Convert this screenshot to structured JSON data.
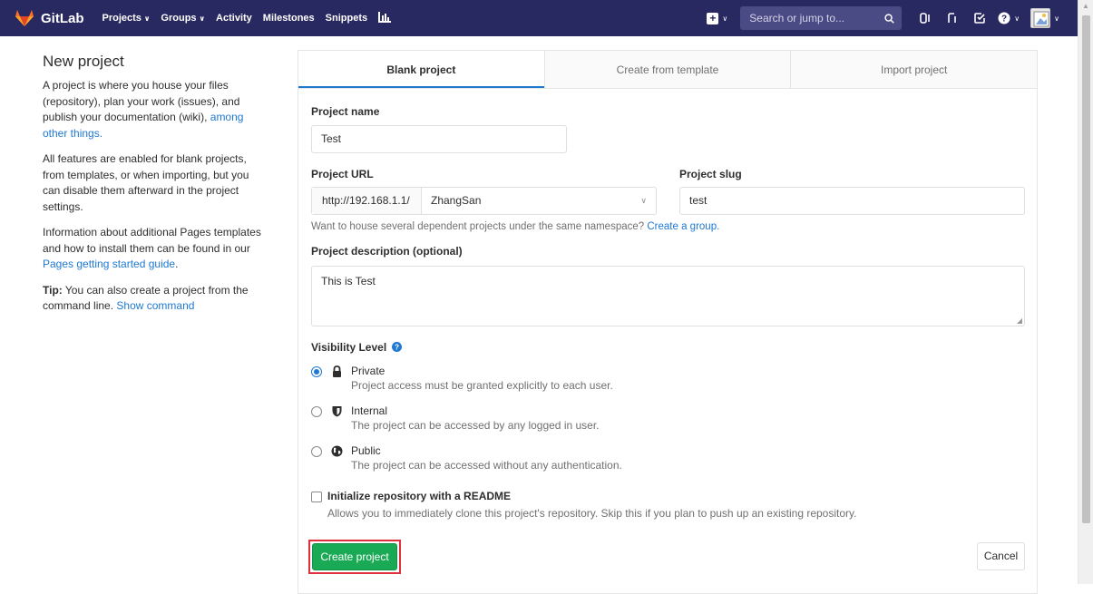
{
  "colors": {
    "nav_bg": "#292961",
    "accent": "#1f78d1",
    "success": "#1aaa55",
    "highlight": "#e0303b"
  },
  "topnav": {
    "brand": "GitLab",
    "links": [
      "Projects",
      "Groups",
      "Activity",
      "Milestones",
      "Snippets"
    ],
    "search_placeholder": "Search or jump to...",
    "icons": [
      "plus-square-icon",
      "search-icon",
      "issues-icon",
      "merge-request-icon",
      "todo-icon",
      "help-icon",
      "avatar"
    ]
  },
  "sidebar": {
    "title": "New project",
    "p1_text": "A project is where you house your files (repository), plan your work (issues), and publish your documentation (wiki),",
    "p1_link": "among other things.",
    "p2": "All features are enabled for blank projects, from templates, or when importing, but you can disable them afterward in the project settings.",
    "p3_text": "Information about additional Pages templates and how to install them can be found in our",
    "p3_link": "Pages getting started guide",
    "p3_end": ".",
    "tip_bold": "Tip:",
    "tip_text": "You can also create a project from the command line.",
    "tip_link": "Show command"
  },
  "tabs": [
    {
      "label": "Blank project",
      "active": true
    },
    {
      "label": "Create from template",
      "active": false
    },
    {
      "label": "Import project",
      "active": false
    }
  ],
  "form": {
    "name_label": "Project name",
    "name_value": "Test",
    "url_label": "Project URL",
    "url_prefix": "http://192.168.1.1/",
    "url_namespace": "ZhangSan",
    "slug_label": "Project slug",
    "slug_value": "test",
    "namespace_help": "Want to house several dependent projects under the same namespace?",
    "namespace_help_link": "Create a group.",
    "desc_label": "Project description (optional)",
    "desc_value": "This is Test",
    "visibility_label": "Visibility Level",
    "visibility": [
      {
        "title": "Private",
        "desc": "Project access must be granted explicitly to each user.",
        "selected": true,
        "icon": "lock-icon"
      },
      {
        "title": "Internal",
        "desc": "The project can be accessed by any logged in user.",
        "selected": false,
        "icon": "shield-icon"
      },
      {
        "title": "Public",
        "desc": "The project can be accessed without any authentication.",
        "selected": false,
        "icon": "globe-icon"
      }
    ],
    "readme_label": "Initialize repository with a README",
    "readme_desc": "Allows you to immediately clone this project's repository. Skip this if you plan to push up an existing repository.",
    "readme_checked": false,
    "create_button": "Create project",
    "cancel_button": "Cancel"
  }
}
